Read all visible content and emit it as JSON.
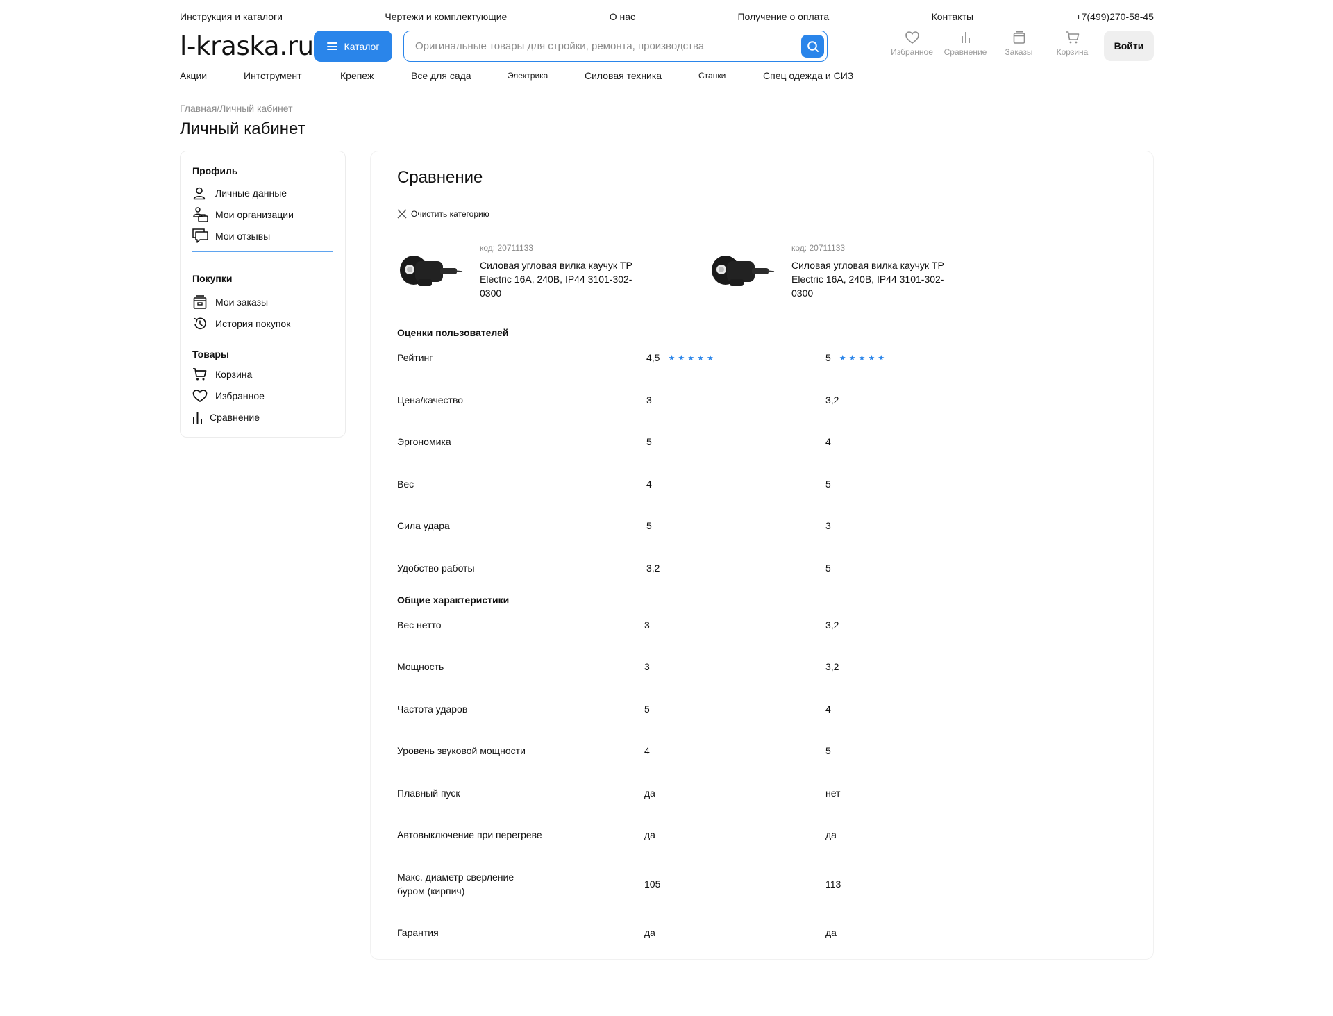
{
  "topbar": {
    "links": [
      "Инструкция и каталоги",
      "Чертежи и комплектующие",
      "О нас",
      "Получение о оплата",
      "Контакты"
    ],
    "phone": "+7(499)270-58-45"
  },
  "header": {
    "logo": "l-kraska.ru",
    "catalog_label": "Каталог",
    "search_placeholder": "Оригинальные товары для стройки, ремонта, производства",
    "icons": [
      {
        "label": "Избранное",
        "icon": "heart-icon"
      },
      {
        "label": "Сравнение",
        "icon": "compare-icon"
      },
      {
        "label": "Заказы",
        "icon": "orders-icon"
      },
      {
        "label": "Корзина",
        "icon": "cart-icon"
      }
    ],
    "login_label": "Войти"
  },
  "catnav": [
    "Акции",
    "Интструмент",
    "Крепеж",
    "Все для сада",
    "Элeктрика",
    "Силовая техника",
    "Станки",
    "Спец одежда и СИЗ"
  ],
  "breadcrumb": "Главная/Личный кабинет",
  "page_title": "Личный кабинет",
  "sidebar": {
    "groups": [
      {
        "title": "Профиль",
        "items": [
          "Личные данные",
          "Мои организации",
          "Мои отзывы"
        ]
      },
      {
        "title": "Покупки",
        "items": [
          "Мои заказы",
          "История покупок"
        ]
      },
      {
        "title": "Товары",
        "items": [
          "Корзина",
          "Избранное",
          "Сравнение"
        ]
      }
    ]
  },
  "compare": {
    "title": "Сравнение",
    "clear_label": "Очистить категорию",
    "products": [
      {
        "code": "код: 20711133",
        "name": "Силовая угловая вилка каучук TP Electric 16А, 240В, IP44 3101-302-0300"
      },
      {
        "code": "код: 20711133",
        "name": "Силовая угловая вилка каучук TP Electric 16А, 240В, IP44 3101-302-0300"
      }
    ],
    "sections": [
      {
        "title": "Оценки пользователей",
        "rows": [
          {
            "label": "Рейтинг",
            "v1": "4,5",
            "v2": "5",
            "stars1": 5,
            "stars2": 5
          },
          {
            "label": "Цена/качество",
            "v1": "3",
            "v2": "3,2"
          },
          {
            "label": "Эргономика",
            "v1": "5",
            "v2": "4"
          },
          {
            "label": "Вес",
            "v1": "4",
            "v2": "5"
          },
          {
            "label": "Сила удара",
            "v1": "5",
            "v2": "3"
          },
          {
            "label": "Удобство работы",
            "v1": "3,2",
            "v2": "5"
          }
        ]
      },
      {
        "title": "Общие характеристики",
        "rows": [
          {
            "label": "Вес нетто",
            "v1": "3",
            "v2": "3,2"
          },
          {
            "label": "Мощность",
            "v1": "3",
            "v2": "3,2"
          },
          {
            "label": "Частота ударов",
            "v1": "5",
            "v2": "4"
          },
          {
            "label": "Уровень звуковой мощности",
            "v1": "4",
            "v2": "5"
          },
          {
            "label": "Плавный пуск",
            "v1": "да",
            "v2": "нет"
          },
          {
            "label": "Автовыключение при перегреве",
            "v1": "да",
            "v2": "да"
          },
          {
            "label": "Макс. диаметр сверление буром (кирпич)",
            "v1": "105",
            "v2": "113"
          },
          {
            "label": "Гарантия",
            "v1": "да",
            "v2": "да"
          }
        ]
      }
    ]
  },
  "colors": {
    "accent": "#2a85ea"
  }
}
